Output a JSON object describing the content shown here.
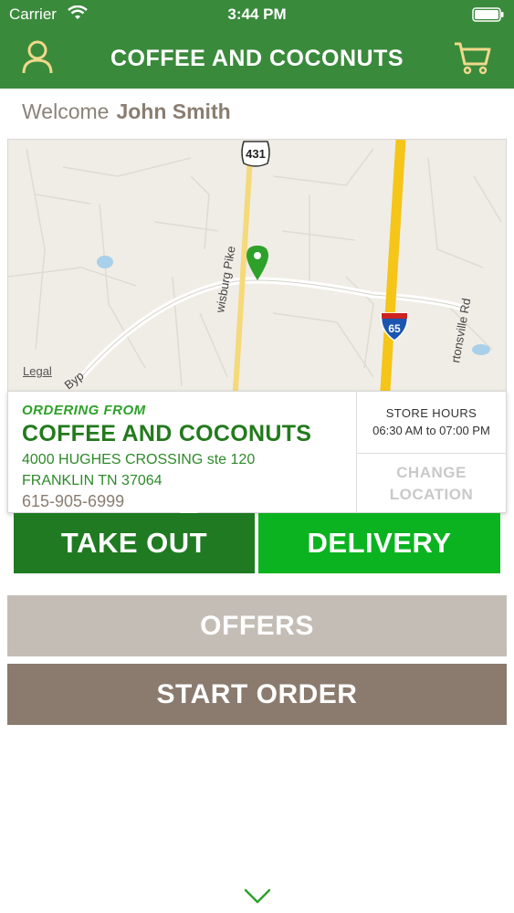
{
  "status_bar": {
    "carrier": "Carrier",
    "time": "3:44 PM"
  },
  "nav": {
    "title": "COFFEE AND COCONUTS",
    "profile_icon": "user-icon",
    "cart_icon": "cart-icon"
  },
  "welcome": {
    "label": "Welcome",
    "user_name": "John Smith"
  },
  "map": {
    "legal_label": "Legal",
    "road_labels": {
      "route_shield": "431",
      "interstate_shield": "65",
      "pike": "wisburg Pike",
      "byp": "Byp",
      "road_right": "rtonsville Rd"
    },
    "pin_icon": "map-pin-icon"
  },
  "store": {
    "ordering_from_label": "ORDERING FROM",
    "name": "COFFEE AND COCONUTS",
    "address_line1": "4000 HUGHES CROSSING ste 120",
    "address_line2": "FRANKLIN TN 37064",
    "phone": "615-905-6999",
    "hours_title": "STORE HOURS",
    "hours_value": "06:30 AM to 07:00 PM",
    "change_location_line1": "CHANGE",
    "change_location_line2": "LOCATION"
  },
  "order_type": {
    "take_out_label": "TAKE OUT",
    "delivery_label": "DELIVERY",
    "selected": "TAKE OUT"
  },
  "actions": {
    "offers_label": "OFFERS",
    "start_order_label": "START ORDER"
  },
  "colors": {
    "header_green": "#3a8a3c",
    "take_out_green": "#1f7a22",
    "delivery_green": "#0cb320",
    "offers_gray": "#c4bdb6",
    "start_order_brown": "#8a7b6e"
  }
}
